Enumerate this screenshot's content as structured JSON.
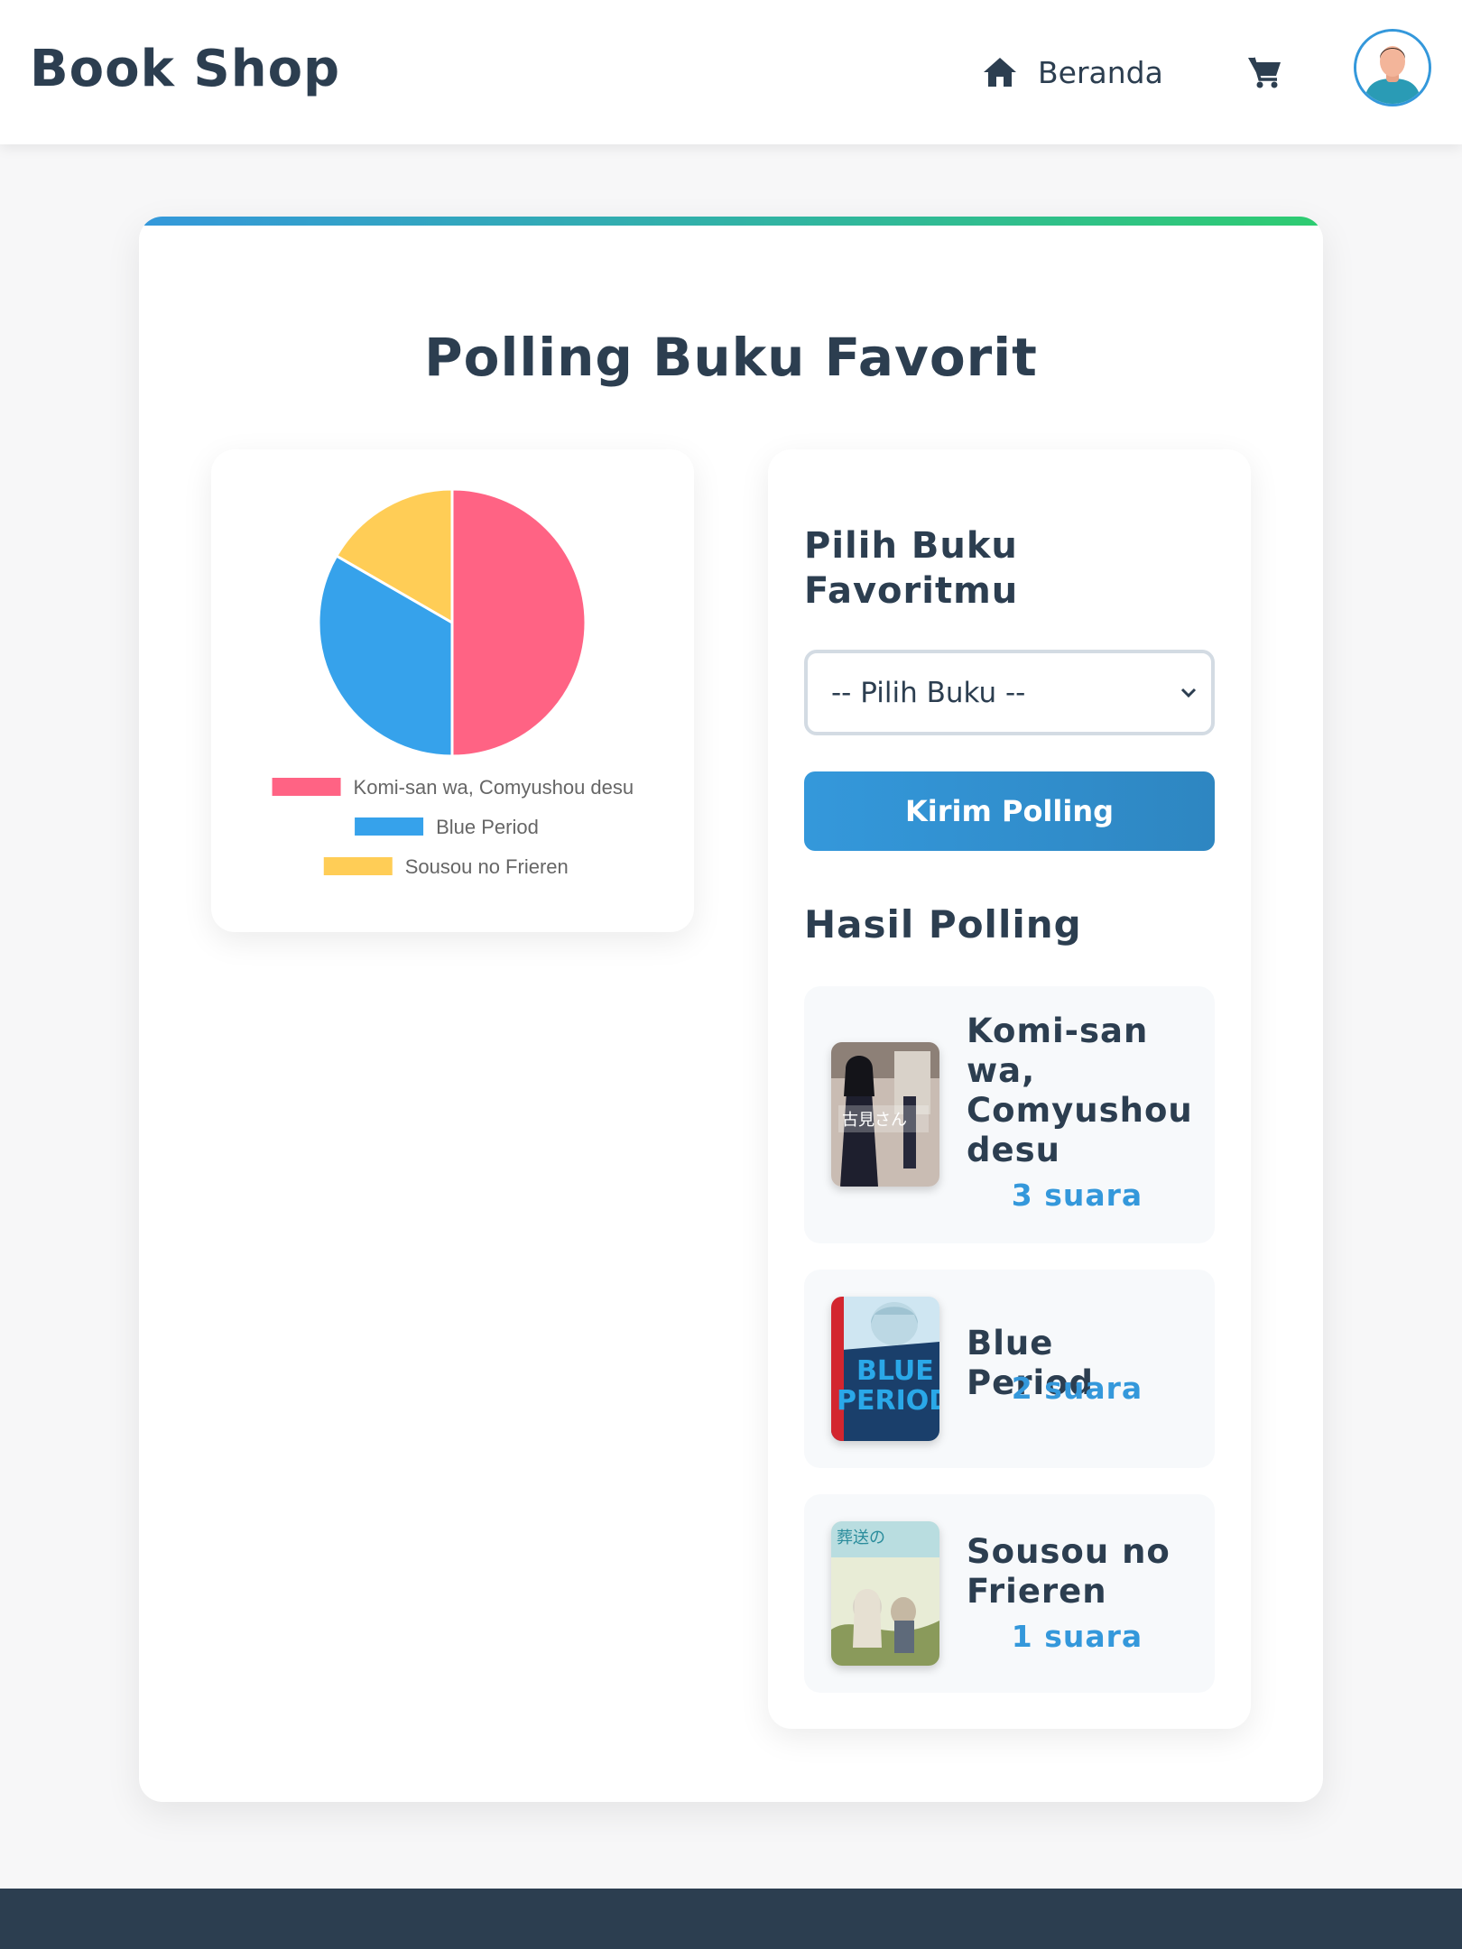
{
  "navbar": {
    "brand": "Book Shop",
    "home_label": "Beranda",
    "home_icon": "home-icon",
    "cart_icon": "cart-icon",
    "avatar_icon": "user-avatar"
  },
  "page": {
    "title": "Polling Buku Favorit"
  },
  "chart_data": {
    "type": "pie",
    "categories": [
      "Komi-san wa, Comyushou desu",
      "Blue Period",
      "Sousou no Frieren"
    ],
    "values": [
      3,
      2,
      1
    ],
    "colors": [
      "#ff6384",
      "#36a2eb",
      "#ffcd56"
    ],
    "legend": "bottom"
  },
  "poll": {
    "heading": "Pilih Buku Favoritmu",
    "select_value": "-- Pilih Buku --",
    "submit_label": "Kirim Polling",
    "results_heading": "Hasil Polling",
    "results": [
      {
        "title": "Komi-san wa, Comyushou desu",
        "votes": "3 suara"
      },
      {
        "title": "Blue Period",
        "votes": "2 suara"
      },
      {
        "title": "Sousou no Frieren",
        "votes": "1 suara"
      }
    ]
  },
  "colors": {
    "accent": "#3498db",
    "accent_end": "#2ecc71",
    "text": "#2c3e50",
    "footer": "#2c3e50"
  }
}
